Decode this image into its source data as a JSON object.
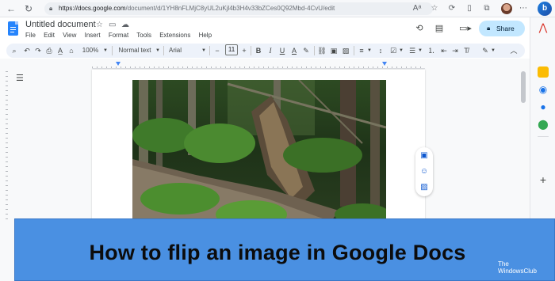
{
  "browser": {
    "url_host": "https://docs.google.com",
    "url_path": "/document/d/1YH8nFLMjC8yUL2uKjl4b3H4v33bZCes0Q92Mbd-4CvU/edit"
  },
  "docs": {
    "title": "Untitled document",
    "menu": [
      "File",
      "Edit",
      "View",
      "Insert",
      "Format",
      "Tools",
      "Extensions",
      "Help"
    ],
    "share_label": "Share"
  },
  "toolbar": {
    "zoom": "100%",
    "style": "Normal text",
    "font": "Arial",
    "font_size": "11",
    "minus": "−",
    "plus": "+"
  },
  "banner": {
    "title": "How to flip an image in Google Docs",
    "watermark_line1": "The",
    "watermark_line2": "WindowsClub"
  },
  "icons": {
    "back": "back-arrow-icon",
    "refresh": "refresh-icon",
    "history": "history-icon",
    "comment": "comment-icon",
    "meet": "video-icon",
    "share_lock": "lock-icon"
  },
  "colors": {
    "share_bg": "#c2e7ff",
    "banner_bg": "#4a90e2",
    "docs_blue": "#2684fc"
  }
}
